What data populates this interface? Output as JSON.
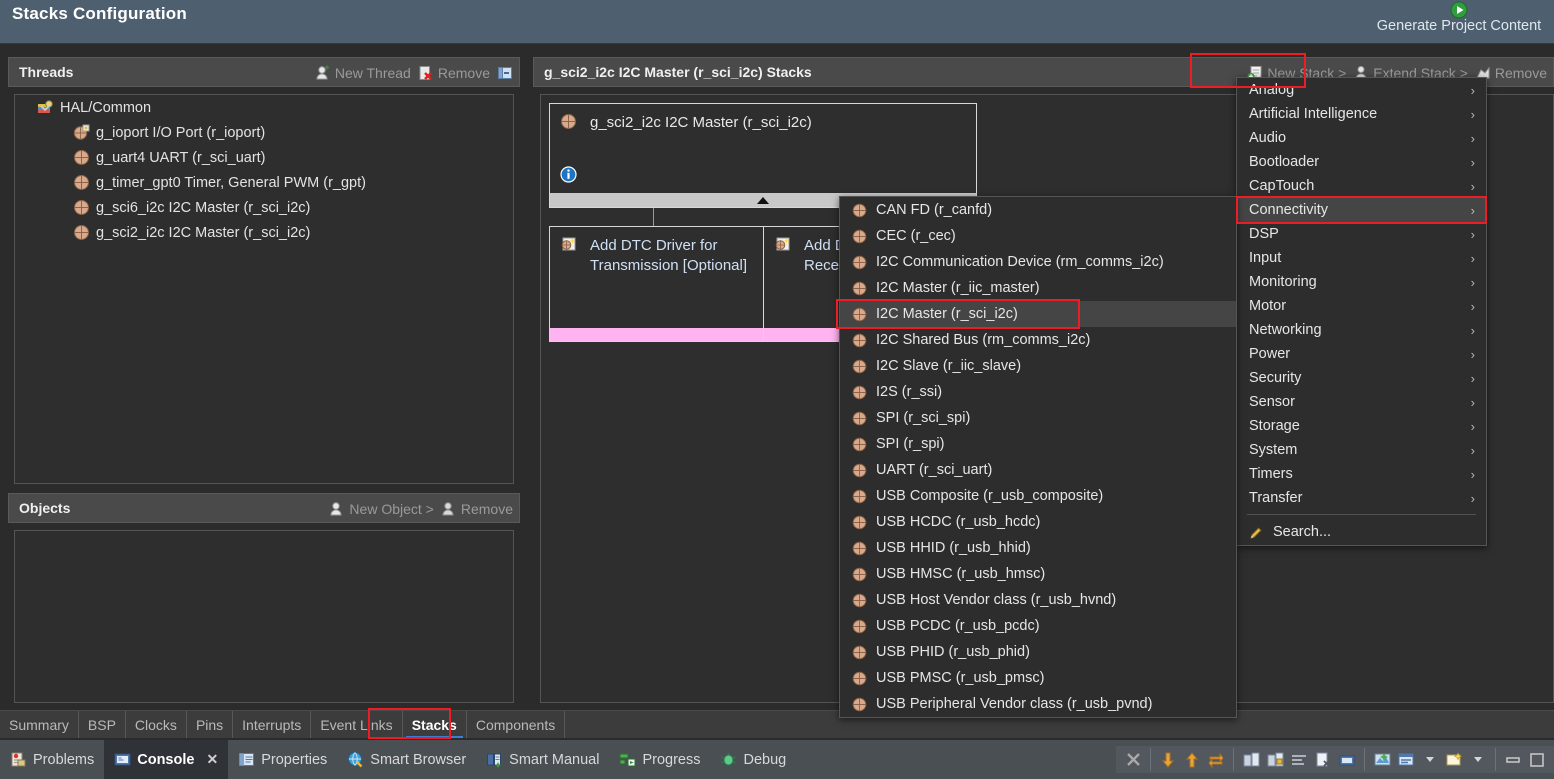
{
  "banner": {
    "title": "Stacks Configuration",
    "generate_label": "Generate Project Content",
    "generate_icon": "play-circle-green-icon"
  },
  "threads_panel": {
    "title": "Threads",
    "actions": [
      {
        "label": "New Thread",
        "icon": "new-thread-icon"
      },
      {
        "label": "Remove",
        "icon": "remove-icon"
      },
      {
        "label": "",
        "icon": "collapse-panel-icon"
      }
    ],
    "tree": [
      {
        "label": "HAL/Common",
        "level": 0,
        "icon": "hal-common-icon",
        "expanded": true
      },
      {
        "label": "g_ioport I/O Port (r_ioport)",
        "level": 1,
        "icon": "module-ioport-icon"
      },
      {
        "label": "g_uart4 UART (r_sci_uart)",
        "level": 1,
        "icon": "module-icon"
      },
      {
        "label": "g_timer_gpt0 Timer, General PWM (r_gpt)",
        "level": 1,
        "icon": "module-icon"
      },
      {
        "label": "g_sci6_i2c I2C Master (r_sci_i2c)",
        "level": 1,
        "icon": "module-icon"
      },
      {
        "label": "g_sci2_i2c I2C Master (r_sci_i2c)",
        "level": 1,
        "icon": "module-icon"
      }
    ]
  },
  "objects_panel": {
    "title": "Objects",
    "actions": [
      {
        "label": "New Object >",
        "icon": "new-object-icon"
      },
      {
        "label": "Remove",
        "icon": "remove-object-icon"
      }
    ]
  },
  "stacks_panel": {
    "title": "g_sci2_i2c I2C Master (r_sci_i2c) Stacks",
    "toolbar": [
      {
        "label": "New Stack >",
        "icon": "new-stack-icon"
      },
      {
        "label": "Extend Stack >",
        "icon": "extend-stack-icon"
      },
      {
        "label": "Remove",
        "icon": "remove-stack-icon"
      }
    ],
    "blocks": [
      {
        "label": "g_sci2_i2c I2C Master (r_sci_i2c)",
        "icon": "module-icon",
        "info_icon": "info-icon"
      },
      {
        "label": "Add DTC Driver for Transmission [Optional]",
        "icon": "add-module-icon"
      },
      {
        "label": "Add DTC Driver for Reception [Optional]",
        "icon": "add-module-icon"
      }
    ]
  },
  "category_menu": {
    "items": [
      {
        "label": "Analog",
        "submenu": true
      },
      {
        "label": "Artificial Intelligence",
        "submenu": true
      },
      {
        "label": "Audio",
        "submenu": true
      },
      {
        "label": "Bootloader",
        "submenu": true
      },
      {
        "label": "CapTouch",
        "submenu": true
      },
      {
        "label": "Connectivity",
        "submenu": true,
        "selected": true
      },
      {
        "label": "DSP",
        "submenu": true
      },
      {
        "label": "Input",
        "submenu": true
      },
      {
        "label": "Monitoring",
        "submenu": true
      },
      {
        "label": "Motor",
        "submenu": true
      },
      {
        "label": "Networking",
        "submenu": true
      },
      {
        "label": "Power",
        "submenu": true
      },
      {
        "label": "Security",
        "submenu": true
      },
      {
        "label": "Sensor",
        "submenu": true
      },
      {
        "label": "Storage",
        "submenu": true
      },
      {
        "label": "System",
        "submenu": true
      },
      {
        "label": "Timers",
        "submenu": true
      },
      {
        "label": "Transfer",
        "submenu": true
      }
    ],
    "search_label": "Search...",
    "search_icon": "search-pencil-icon"
  },
  "connectivity_menu": {
    "items": [
      {
        "label": "CAN FD (r_canfd)"
      },
      {
        "label": "CEC (r_cec)"
      },
      {
        "label": "I2C Communication Device (rm_comms_i2c)"
      },
      {
        "label": "I2C Master (r_iic_master)"
      },
      {
        "label": "I2C Master (r_sci_i2c)",
        "selected": true
      },
      {
        "label": "I2C Shared Bus (rm_comms_i2c)"
      },
      {
        "label": "I2C Slave (r_iic_slave)"
      },
      {
        "label": "I2S (r_ssi)"
      },
      {
        "label": "SPI (r_sci_spi)"
      },
      {
        "label": "SPI (r_spi)"
      },
      {
        "label": "UART (r_sci_uart)"
      },
      {
        "label": "USB Composite (r_usb_composite)"
      },
      {
        "label": "USB HCDC (r_usb_hcdc)"
      },
      {
        "label": "USB HHID (r_usb_hhid)"
      },
      {
        "label": "USB HMSC (r_usb_hmsc)"
      },
      {
        "label": "USB Host Vendor class (r_usb_hvnd)"
      },
      {
        "label": "USB PCDC (r_usb_pcdc)"
      },
      {
        "label": "USB PHID (r_usb_phid)"
      },
      {
        "label": "USB PMSC (r_usb_pmsc)"
      },
      {
        "label": "USB Peripheral Vendor class (r_usb_pvnd)"
      }
    ]
  },
  "config_tabs": [
    {
      "label": "Summary"
    },
    {
      "label": "BSP"
    },
    {
      "label": "Clocks"
    },
    {
      "label": "Pins"
    },
    {
      "label": "Interrupts"
    },
    {
      "label": "Event Links"
    },
    {
      "label": "Stacks",
      "active": true
    },
    {
      "label": "Components"
    }
  ],
  "view_tabs": [
    {
      "label": "Problems",
      "icon": "problems-icon",
      "active": false
    },
    {
      "label": "Console",
      "icon": "console-icon",
      "active": true,
      "closable": true
    },
    {
      "label": "Properties",
      "icon": "properties-icon",
      "active": false
    },
    {
      "label": "Smart Browser",
      "icon": "smart-browser-icon",
      "active": false
    },
    {
      "label": "Smart Manual",
      "icon": "smart-manual-icon",
      "active": false
    },
    {
      "label": "Progress",
      "icon": "progress-icon",
      "active": false
    },
    {
      "label": "Debug",
      "icon": "debug-icon",
      "active": false
    }
  ],
  "view_toolbar": [
    {
      "icon": "terminate-x-icon"
    },
    {
      "icon": "scroll-down-icon"
    },
    {
      "icon": "scroll-up-icon"
    },
    {
      "icon": "swap-arrows-icon"
    },
    {
      "icon": "clear-console-icon"
    },
    {
      "icon": "lock-scroll-icon"
    },
    {
      "icon": "word-wrap-icon"
    },
    {
      "icon": "clear-log-icon"
    },
    {
      "icon": "show-console-icon"
    },
    {
      "icon": "open-console-icon"
    },
    {
      "icon": "display-console-icon"
    },
    {
      "icon": "new-console-icon"
    },
    {
      "icon": "minimize-icon"
    },
    {
      "icon": "maximize-icon"
    }
  ],
  "colors": {
    "banner": "#4e6070",
    "accent_red": "#ee1c25",
    "selection": "#454545",
    "pink_bar": "#ffb3f0",
    "tab_underline": "#3a7fd5"
  }
}
